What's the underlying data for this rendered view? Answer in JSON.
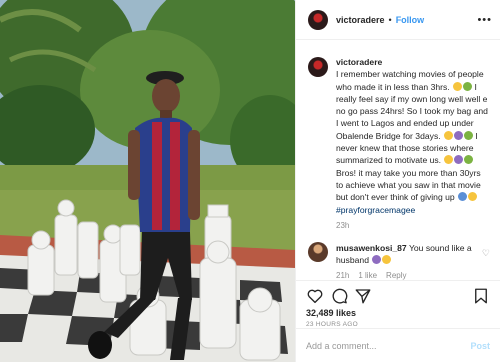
{
  "post": {
    "username": "victoradere",
    "separator": "•",
    "follow_label": "Follow",
    "more_label": "•••",
    "caption_text_1": "I remember watching movies of people who made it in less than 3hrs.",
    "caption_text_2": " I really feel say if my own long well well e no go pass 24hrs! So I took my bag and I went to Lagos and ended up under Obalende Bridge for 3days.",
    "caption_text_3": " I never knew that those stories where summarized to motivate us.",
    "caption_text_4": " Bros! it may take you more than 30yrs to achieve what you saw in that movie but don't ever think of giving up",
    "hashtag": "#prayforgracemagee",
    "caption_time": "23h"
  },
  "reply": {
    "username": "musawenkosi_87",
    "text": "You sound like a husband",
    "time": "21h",
    "likes": "1 like",
    "reply_label": "Reply"
  },
  "actions": {
    "likes": "32,489 likes",
    "time": "23 HOURS AGO"
  },
  "comment_box": {
    "placeholder": "Add a comment...",
    "post_label": "Post"
  },
  "colors": {
    "accent": "#3897f0",
    "post_disabled": "#b2dffc",
    "muted": "#8e8e8e"
  },
  "icons": [
    "heart-icon",
    "comment-icon",
    "share-icon",
    "bookmark-icon",
    "more-icon"
  ]
}
